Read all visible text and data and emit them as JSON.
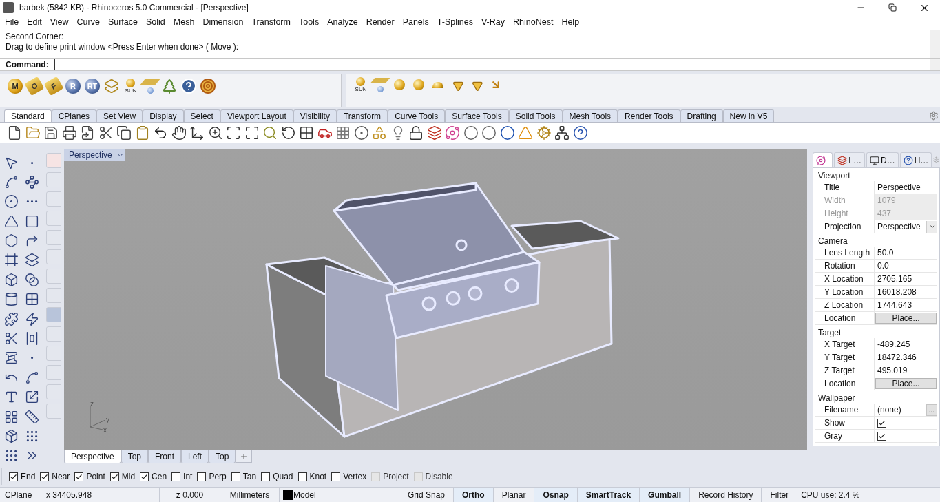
{
  "window": {
    "title": "barbek (5842 KB) - Rhinoceros 5.0 Commercial - [Perspective]"
  },
  "menu": [
    "File",
    "Edit",
    "View",
    "Curve",
    "Surface",
    "Solid",
    "Mesh",
    "Dimension",
    "Transform",
    "Tools",
    "Analyze",
    "Render",
    "Panels",
    "T-Splines",
    "V-Ray",
    "RhinoNest",
    "Help"
  ],
  "command_history": [
    "Second Corner:",
    "Drag to define print window <Press Enter when done> ( Move ):"
  ],
  "command_line": {
    "label": "Command:"
  },
  "toolbar_left": [
    {
      "kind": "ball",
      "text": "M"
    },
    {
      "kind": "tag",
      "text": "O"
    },
    {
      "kind": "tag",
      "text": "F"
    },
    {
      "kind": "ball",
      "text": "R"
    },
    {
      "kind": "ball",
      "text": "RT"
    },
    {
      "kind": "grid"
    },
    {
      "kind": "sun",
      "text": "SUN"
    },
    {
      "kind": "light"
    },
    {
      "kind": "tree"
    },
    {
      "kind": "help"
    },
    {
      "kind": "target"
    }
  ],
  "toolbar_right": [
    {
      "kind": "sun",
      "text": "SUN"
    },
    {
      "kind": "light"
    },
    {
      "kind": "sphere"
    },
    {
      "kind": "sphere"
    },
    {
      "kind": "dome"
    },
    {
      "kind": "spot"
    },
    {
      "kind": "spot"
    },
    {
      "kind": "arrow"
    }
  ],
  "tabs": [
    {
      "label": "Standard",
      "selected": true
    },
    {
      "label": "CPlanes",
      "selected": false
    },
    {
      "label": "Set View",
      "selected": false
    },
    {
      "label": "Display",
      "selected": false
    },
    {
      "label": "Select",
      "selected": false
    },
    {
      "label": "Viewport Layout",
      "selected": false
    },
    {
      "label": "Visibility",
      "selected": false
    },
    {
      "label": "Transform",
      "selected": false
    },
    {
      "label": "Curve Tools",
      "selected": false
    },
    {
      "label": "Surface Tools",
      "selected": false
    },
    {
      "label": "Solid Tools",
      "selected": false
    },
    {
      "label": "Mesh Tools",
      "selected": false
    },
    {
      "label": "Render Tools",
      "selected": false
    },
    {
      "label": "Drafting",
      "selected": false
    },
    {
      "label": "New in V5",
      "selected": false
    }
  ],
  "viewport": {
    "title": "Perspective",
    "axes": [
      "z",
      "y",
      "x"
    ]
  },
  "viewport_tabs": [
    {
      "label": "Perspective",
      "selected": true
    },
    {
      "label": "Top",
      "selected": false
    },
    {
      "label": "Front",
      "selected": false
    },
    {
      "label": "Left",
      "selected": false
    },
    {
      "label": "Top",
      "selected": false
    }
  ],
  "panel_tabs": [
    {
      "selected": true
    },
    {
      "label": "L…",
      "selected": false
    },
    {
      "label": "D…",
      "selected": false
    },
    {
      "label": "H…",
      "selected": false
    }
  ],
  "properties": [
    {
      "section": "Viewport",
      "rows": [
        {
          "kind": "text",
          "label": "Title",
          "value": "Perspective"
        },
        {
          "kind": "disabled",
          "label": "Width",
          "value": "1079"
        },
        {
          "kind": "disabled",
          "label": "Height",
          "value": "437"
        },
        {
          "kind": "dropdown",
          "label": "Projection",
          "value": "Perspective"
        }
      ]
    },
    {
      "section": "Camera",
      "rows": [
        {
          "kind": "text",
          "label": "Lens Length",
          "value": "50.0"
        },
        {
          "kind": "text",
          "label": "Rotation",
          "value": "0.0"
        },
        {
          "kind": "text",
          "label": "X Location",
          "value": "2705.165"
        },
        {
          "kind": "text",
          "label": "Y Location",
          "value": "16018.208"
        },
        {
          "kind": "text",
          "label": "Z Location",
          "value": "1744.643"
        },
        {
          "kind": "button",
          "label": "Location",
          "value": "Place..."
        }
      ]
    },
    {
      "section": "Target",
      "rows": [
        {
          "kind": "text",
          "label": "X Target",
          "value": "-489.245"
        },
        {
          "kind": "text",
          "label": "Y Target",
          "value": "18472.346"
        },
        {
          "kind": "text",
          "label": "Z Target",
          "value": "495.019"
        },
        {
          "kind": "button",
          "label": "Location",
          "value": "Place..."
        }
      ]
    },
    {
      "section": "Wallpaper",
      "rows": [
        {
          "kind": "file",
          "label": "Filename",
          "value": "(none)",
          "button": "..."
        },
        {
          "kind": "checkbox",
          "label": "Show",
          "checked": true
        },
        {
          "kind": "checkbox",
          "label": "Gray",
          "checked": true
        }
      ]
    }
  ],
  "osnaps": [
    {
      "label": "End",
      "checked": true,
      "disabled": false
    },
    {
      "label": "Near",
      "checked": true,
      "disabled": false
    },
    {
      "label": "Point",
      "checked": true,
      "disabled": false
    },
    {
      "label": "Mid",
      "checked": true,
      "disabled": false
    },
    {
      "label": "Cen",
      "checked": true,
      "disabled": false
    },
    {
      "label": "Int",
      "checked": false,
      "disabled": false
    },
    {
      "label": "Perp",
      "checked": false,
      "disabled": false
    },
    {
      "label": "Tan",
      "checked": false,
      "disabled": false
    },
    {
      "label": "Quad",
      "checked": false,
      "disabled": false
    },
    {
      "label": "Knot",
      "checked": false,
      "disabled": false
    },
    {
      "label": "Vertex",
      "checked": false,
      "disabled": false
    },
    {
      "label": "Project",
      "checked": false,
      "disabled": true
    },
    {
      "label": "Disable",
      "checked": false,
      "disabled": true
    }
  ],
  "status_bar": {
    "cplane": "CPlane",
    "x": "x 34405.948",
    "z": "z 0.000",
    "units": "Millimeters",
    "layer": "Model",
    "toggles": [
      {
        "label": "Grid Snap",
        "on": false
      },
      {
        "label": "Ortho",
        "on": true
      },
      {
        "label": "Planar",
        "on": false
      },
      {
        "label": "Osnap",
        "on": true
      },
      {
        "label": "SmartTrack",
        "on": true
      },
      {
        "label": "Gumball",
        "on": true
      },
      {
        "label": "Record History",
        "on": false
      },
      {
        "label": "Filter",
        "on": false
      }
    ],
    "cpu": "CPU use: 2.4 %"
  }
}
